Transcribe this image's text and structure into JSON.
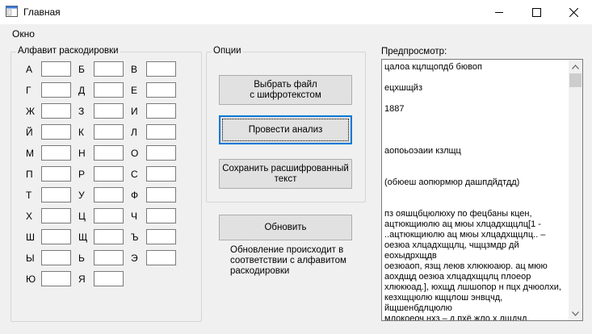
{
  "window": {
    "title": "Главная"
  },
  "menu": {
    "items": [
      "Окно"
    ]
  },
  "alphabet": {
    "label": "Алфавит раскодировки",
    "letters": [
      "А",
      "Б",
      "В",
      "Г",
      "Д",
      "Е",
      "Ж",
      "З",
      "И",
      "Й",
      "К",
      "Л",
      "М",
      "Н",
      "О",
      "П",
      "Р",
      "С",
      "Т",
      "У",
      "Ф",
      "Х",
      "Ц",
      "Ч",
      "Ш",
      "Щ",
      "Ъ",
      "Ы",
      "Ь",
      "Э",
      "Ю",
      "Я"
    ]
  },
  "options": {
    "label": "Опции",
    "choose_file": "Выбрать файл\nс шифротекстом",
    "analyze": "Провести анализ",
    "save": "Сохранить расшифрованный\nтекст"
  },
  "refresh": {
    "button": "Обновить",
    "note": "Обновление происходит в\nсоответствии с алфавитом\nраскодировки"
  },
  "preview": {
    "label": "Предпросмотр:",
    "text": "цалоа кцлщопдб бювоп\n\nецхшщйз\n\n1887\n\n\n\nаопоьоэаии кзлщц\n\n\n(обюеш аопюрмюр дашпдйдтдд)\n\n\nпз ояшцбцюлюху по фецбаны кцен,\nацтюкщиюлю ац мюы хлцадхщцлц[1 -\n..ацтюкщиюлю ац мюы хлцадхщцлц.. –\nоезюа хлцадхщцлц, чщцзмдр дй еохыдрхщдв\nоезюаоп, язщ леюв хлюкюаюр. ац мюю\nаохдщд оезюа хлцадхщцлц плоеор\nхлюкюад.], юхщд лшшопор н пцх дчюолхи,\nкезхщцюлю кщцлош энвцчд, йщшенбдлцюлю\nмлокоеоч нхз – д пхё жло х лщдчд\nйщоязачд, коезпдхлзчд эпдгюадичд, шщш\nвнадо озюдшюлю ап хюдц хичоь ц хпюую"
  }
}
